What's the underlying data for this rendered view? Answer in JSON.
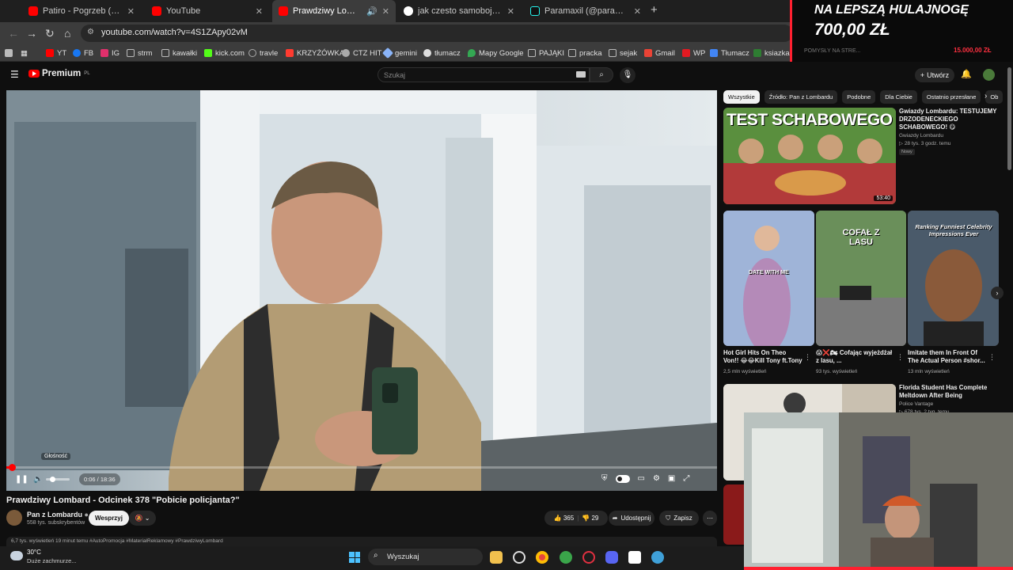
{
  "browser": {
    "tabs": [
      {
        "title": "Patiro - Pogrzeb (prod. Bero) - Y",
        "fav": "#ff0000",
        "active": false
      },
      {
        "title": "YouTube",
        "fav": "#ff0000",
        "active": false
      },
      {
        "title": "Prawdziwy Lombard - Odci",
        "fav": "#ff0000",
        "active": true
      },
      {
        "title": "jak czesto samobojcy zostawiaj",
        "fav": "#ffffff",
        "active": false
      },
      {
        "title": "Paramaxil (@paramaxil_) | TikTo",
        "fav": "#111111",
        "active": false
      }
    ],
    "url": "youtube.com/watch?v=4S1ZApy02vM",
    "bookmarks": [
      {
        "label": "YT",
        "color": "#ff0000"
      },
      {
        "label": "FB",
        "color": "#1877f2"
      },
      {
        "label": "IG",
        "color": "#e1306c"
      },
      {
        "label": "strm",
        "color": "#888888"
      },
      {
        "label": "kawałki",
        "color": "#888888"
      },
      {
        "label": "kick.com",
        "color": "#53fc18"
      },
      {
        "label": "travle",
        "color": "#aaaaaa"
      },
      {
        "label": "KRZYŻÓWKA",
        "color": "#ff3b30"
      },
      {
        "label": "CTZ HIT",
        "color": "#aaaaaa"
      },
      {
        "label": "gemini",
        "color": "#8ab4f8"
      },
      {
        "label": "tłumacz",
        "color": "#dddddd"
      },
      {
        "label": "Mapy Google",
        "color": "#34a853"
      },
      {
        "label": "PAJĄKI",
        "color": "#888888"
      },
      {
        "label": "pracka",
        "color": "#888888"
      },
      {
        "label": "sejak",
        "color": "#888888"
      },
      {
        "label": "Gmail",
        "color": "#ea4335"
      },
      {
        "label": "WP",
        "color": "#e21a22"
      },
      {
        "label": "Tłumacz",
        "color": "#4285f4"
      },
      {
        "label": "ksiazka",
        "color": "#2e7d32"
      }
    ]
  },
  "ad": {
    "line1": "NA LEPSZĄ HULAJNOGĘ",
    "line2": "700,00 ZŁ",
    "ghost": "POMYSŁY NA STRE...",
    "ghost2": "15.000,00 ZŁ"
  },
  "youtube": {
    "logo_text": "Premium",
    "logo_country": "PL",
    "search_placeholder": "Szukaj",
    "create_label": "Utwórz",
    "player": {
      "time": "0:06 / 18:36",
      "progress_fraction": 0.0055,
      "volume_tooltip": "Głośność"
    },
    "video": {
      "title": "Prawdziwy Lombard - Odcinek 378 \"Pobicie policjanta?\"",
      "channel": "Pan z Lombardu",
      "subscribers": "558 tys. subskrybentów",
      "support_label": "Wesprzyj",
      "likes": "365",
      "comments": "29",
      "share_label": "Udostępnij",
      "save_label": "Zapisz",
      "description": "6,7 tys. wyświetleń  19 minut temu  #AutoPromocja #MateriałReklamowy #PrawdziwyLombard"
    },
    "chips": [
      "Wszystkie",
      "Źródło: Pan z Lombardu",
      "Podobne",
      "Dla Ciebie",
      "Ostatnio przesłane",
      "Ob"
    ],
    "rec1": {
      "thumb_text": "TEST SCHABOWEGO",
      "duration": "53:40",
      "title": "Gwiazdy Lombardu: TESTUJEMY DRZODENECKIEGO SCHABOWEGO! 😋",
      "channel": "Gwiazdy Lombardu",
      "meta": "28 tys.  3 godz. temu",
      "badge": "Nowy"
    },
    "shorts": [
      {
        "overlay": "DATE WITH ME",
        "title": "Hot Girl Hits On Theo Von!! 😂😂Kill Tony ft.Tony ...",
        "views": "2,5 mln wyświetleń"
      },
      {
        "overlay": "COFAŁ Z LASU",
        "title": "😱❌🏍 Cofając wyjeżdżał z lasu, ...",
        "views": "93 tys. wyświetleń"
      },
      {
        "overlay": "Ranking Funniest Celebrity Impressions Ever",
        "title": "Imitate them In Front Of The Actual Person #shor...",
        "views": "13 mln wyświetleń"
      }
    ],
    "rec2": {
      "title": "Florida Student Has Complete Meltdown After Being Misgendered",
      "channel": "Police Vantage",
      "meta": "678 tys.  2 tyg. temu"
    }
  },
  "taskbar": {
    "temperature": "30°C",
    "weather": "Duże zachmurze...",
    "search_label": "Wyszukaj"
  }
}
